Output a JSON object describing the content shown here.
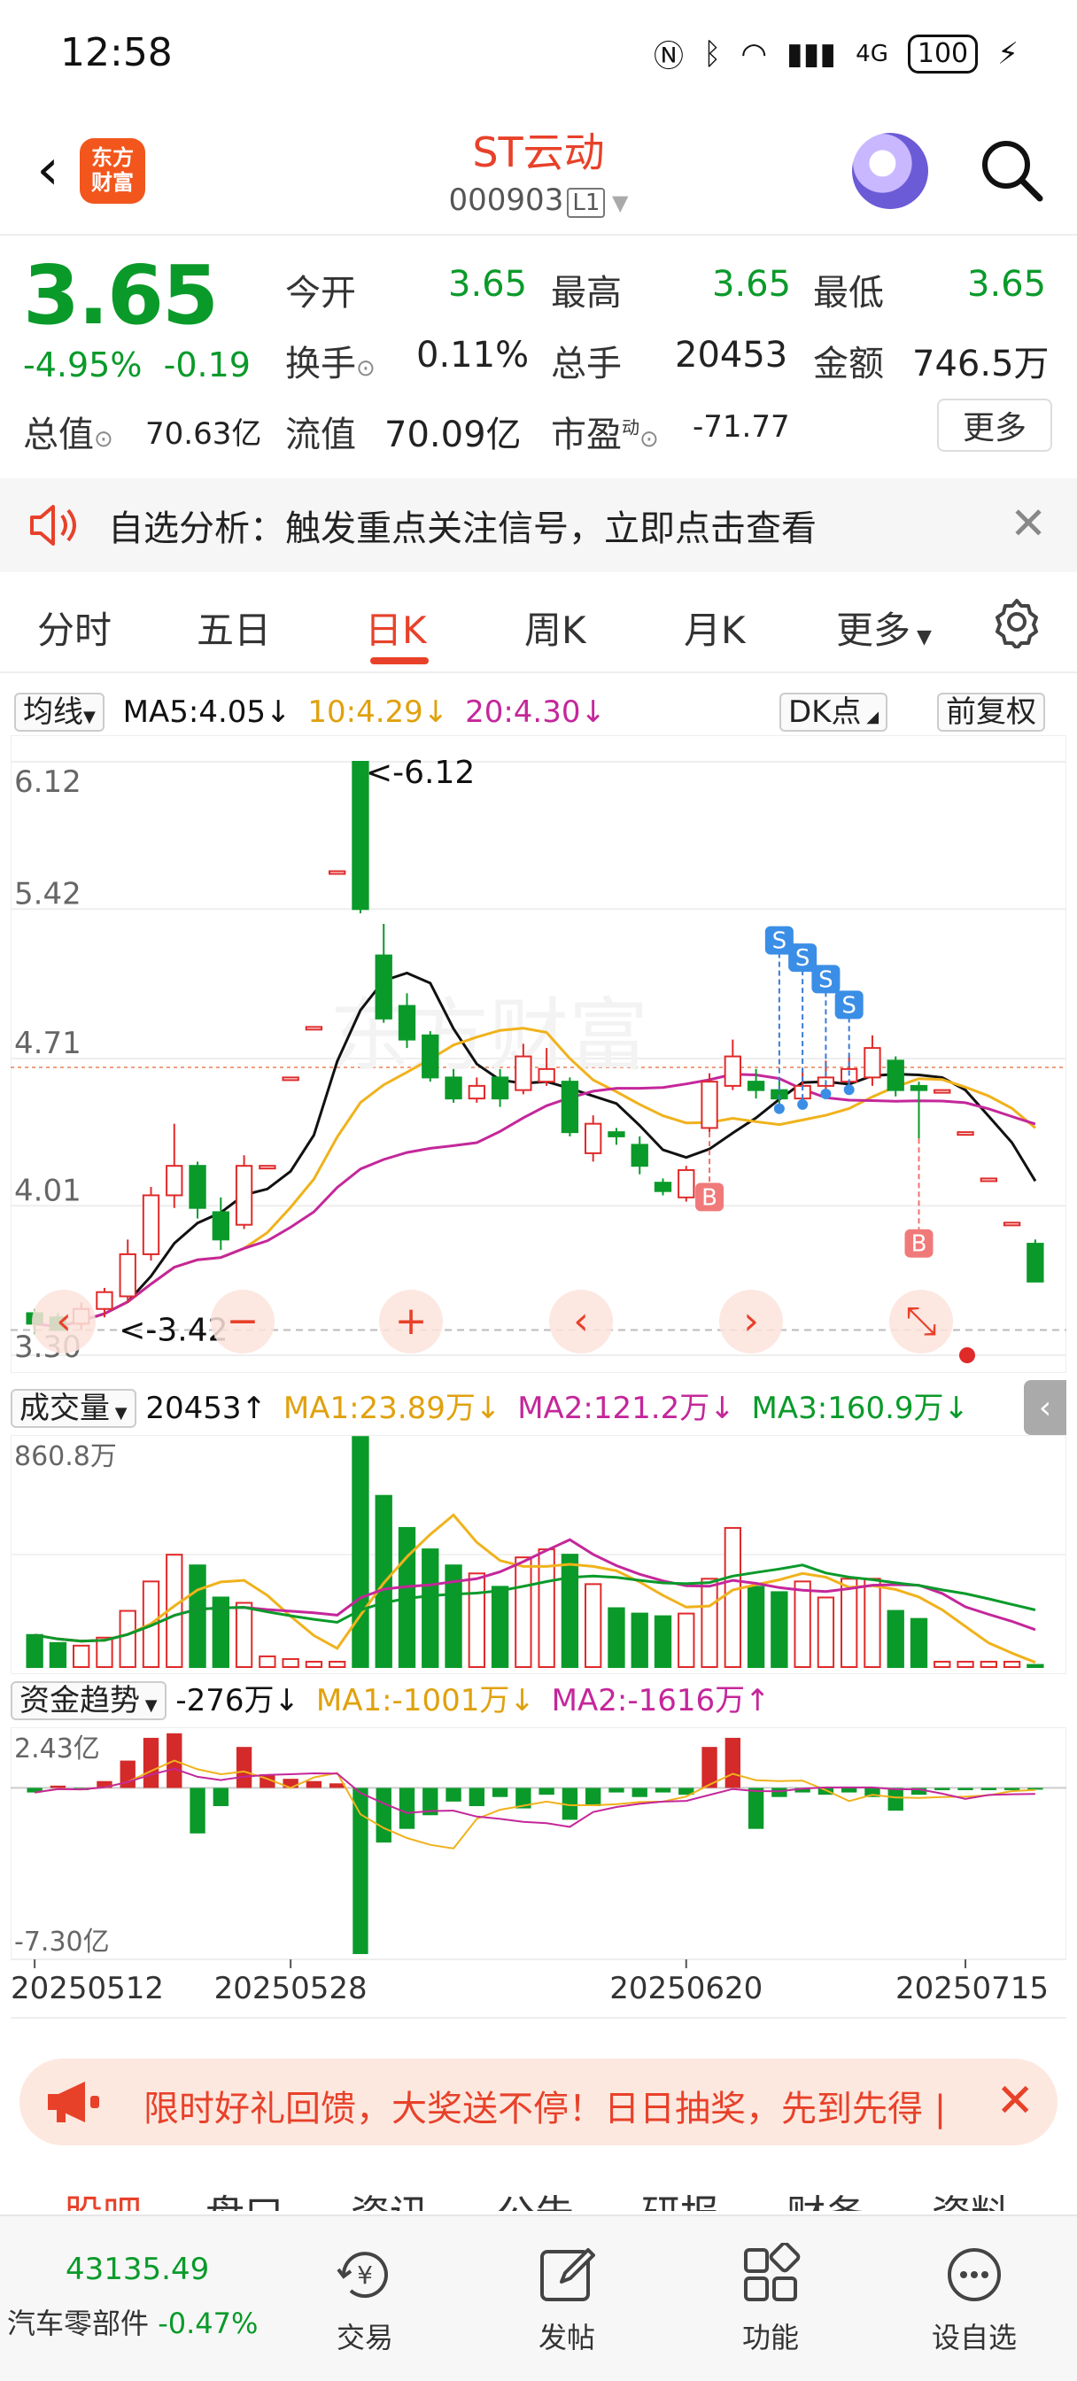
{
  "status_bar": {
    "time": "12:58",
    "network": "4G",
    "battery": "100"
  },
  "header": {
    "back_icon": "back-arrow-icon",
    "logo_line1": "东方",
    "logo_line2": "财富",
    "title": "ST云动",
    "code": "000903",
    "level": "L1"
  },
  "quote": {
    "price": "3.65",
    "change_pct": "-4.95%",
    "change": "-0.19",
    "open_label": "今开",
    "open": "3.65",
    "high_label": "最高",
    "high": "3.65",
    "low_label": "最低",
    "low": "3.65",
    "turnover_label": "换手",
    "turnover": "0.11%",
    "volume_label": "总手",
    "volume": "20453",
    "amount_label": "金额",
    "amount": "746.5万",
    "mktcap_label": "总值",
    "mktcap": "70.63亿",
    "float_label": "流值",
    "float_cap": "70.09亿",
    "pe_label": "市盈",
    "pe_sup": "动",
    "pe": "-71.77",
    "more": "更多"
  },
  "notice": {
    "text": "自选分析：触发重点关注信号，立即点击查看"
  },
  "tabs": [
    "分时",
    "五日",
    "日K",
    "周K",
    "月K",
    "更多"
  ],
  "active_tab": "日K",
  "kline": {
    "ma_selector": "均线",
    "ma5": "MA5:4.05↓",
    "ma10": "10:4.29↓",
    "ma20": "20:4.30↓",
    "dk": "DK点",
    "adjust": "前复权",
    "high_mark": "<-6.12",
    "low_mark": "<-3.42"
  },
  "volume": {
    "selector": "成交量",
    "value": "20453↑",
    "ma1": "MA1:23.89万↓",
    "ma2": "MA2:121.2万↓",
    "ma3": "MA3:160.9万↓",
    "max_label": "860.8万"
  },
  "fund": {
    "selector": "资金趋势",
    "value": "-276万↓",
    "ma1": "MA1:-1001万↓",
    "ma2": "MA2:-1616万↑",
    "max_label": "2.43亿",
    "min_label": "-7.30亿"
  },
  "dates": [
    "20250512",
    "20250528",
    "20250620",
    "20250715"
  ],
  "chart_data": {
    "type": "candlestick",
    "title": "",
    "ylim": [
      3.3,
      6.12
    ],
    "yticks": [
      6.12,
      5.42,
      4.71,
      4.01,
      3.3
    ],
    "candles": [
      {
        "o": 3.5,
        "c": 3.45,
        "h": 3.52,
        "l": 3.4
      },
      {
        "o": 3.48,
        "c": 3.42,
        "h": 3.5,
        "l": 3.42
      },
      {
        "o": 3.45,
        "c": 3.52,
        "h": 3.55,
        "l": 3.42
      },
      {
        "o": 3.52,
        "c": 3.6,
        "h": 3.62,
        "l": 3.48
      },
      {
        "o": 3.58,
        "c": 3.78,
        "h": 3.85,
        "l": 3.55
      },
      {
        "o": 3.78,
        "c": 4.06,
        "h": 4.1,
        "l": 3.75
      },
      {
        "o": 4.06,
        "c": 4.2,
        "h": 4.4,
        "l": 4.0
      },
      {
        "o": 4.2,
        "c": 4.0,
        "h": 4.22,
        "l": 3.95
      },
      {
        "o": 3.98,
        "c": 3.85,
        "h": 4.05,
        "l": 3.8
      },
      {
        "o": 3.92,
        "c": 4.2,
        "h": 4.25,
        "l": 3.9
      },
      {
        "o": 4.2,
        "c": 4.2,
        "h": 4.2,
        "l": 4.2
      },
      {
        "o": 4.62,
        "c": 4.62,
        "h": 4.62,
        "l": 4.62
      },
      {
        "o": 4.86,
        "c": 4.86,
        "h": 4.86,
        "l": 4.86
      },
      {
        "o": 5.6,
        "c": 5.6,
        "h": 5.6,
        "l": 5.6
      },
      {
        "o": 6.12,
        "c": 5.42,
        "h": 6.12,
        "l": 5.4
      },
      {
        "o": 5.2,
        "c": 4.9,
        "h": 5.35,
        "l": 4.88
      },
      {
        "o": 4.96,
        "c": 4.8,
        "h": 5.02,
        "l": 4.76
      },
      {
        "o": 4.82,
        "c": 4.62,
        "h": 4.84,
        "l": 4.6
      },
      {
        "o": 4.62,
        "c": 4.52,
        "h": 4.66,
        "l": 4.5
      },
      {
        "o": 4.52,
        "c": 4.58,
        "h": 4.62,
        "l": 4.5
      },
      {
        "o": 4.62,
        "c": 4.52,
        "h": 4.66,
        "l": 4.48
      },
      {
        "o": 4.56,
        "c": 4.72,
        "h": 4.78,
        "l": 4.54
      },
      {
        "o": 4.6,
        "c": 4.66,
        "h": 4.76,
        "l": 4.58
      },
      {
        "o": 4.6,
        "c": 4.36,
        "h": 4.62,
        "l": 4.34
      },
      {
        "o": 4.26,
        "c": 4.4,
        "h": 4.44,
        "l": 4.22
      },
      {
        "o": 4.36,
        "c": 4.34,
        "h": 4.38,
        "l": 4.3
      },
      {
        "o": 4.3,
        "c": 4.2,
        "h": 4.34,
        "l": 4.16
      },
      {
        "o": 4.12,
        "c": 4.08,
        "h": 4.14,
        "l": 4.06
      },
      {
        "o": 4.05,
        "c": 4.18,
        "h": 4.2,
        "l": 4.03
      },
      {
        "o": 4.38,
        "c": 4.6,
        "h": 4.64,
        "l": 4.36
      },
      {
        "o": 4.58,
        "c": 4.72,
        "h": 4.8,
        "l": 4.56
      },
      {
        "o": 4.6,
        "c": 4.56,
        "h": 4.66,
        "l": 4.52
      },
      {
        "o": 4.56,
        "c": 4.52,
        "h": 4.62,
        "l": 4.48
      },
      {
        "o": 4.52,
        "c": 4.58,
        "h": 4.66,
        "l": 4.5
      },
      {
        "o": 4.58,
        "c": 4.62,
        "h": 4.7,
        "l": 4.55
      },
      {
        "o": 4.6,
        "c": 4.66,
        "h": 4.72,
        "l": 4.57
      },
      {
        "o": 4.62,
        "c": 4.76,
        "h": 4.82,
        "l": 4.58
      },
      {
        "o": 4.7,
        "c": 4.56,
        "h": 4.72,
        "l": 4.53
      },
      {
        "o": 4.58,
        "c": 4.56,
        "h": 4.6,
        "l": 4.33
      },
      {
        "o": 4.56,
        "c": 4.56,
        "h": 4.56,
        "l": 4.56
      },
      {
        "o": 4.36,
        "c": 4.36,
        "h": 4.36,
        "l": 4.36
      },
      {
        "o": 4.14,
        "c": 4.14,
        "h": 4.14,
        "l": 4.14
      },
      {
        "o": 3.93,
        "c": 3.93,
        "h": 3.93,
        "l": 3.93
      },
      {
        "o": 3.83,
        "c": 3.65,
        "h": 3.85,
        "l": 3.65
      }
    ],
    "volume": [
      120,
      90,
      80,
      110,
      210,
      320,
      420,
      380,
      260,
      240,
      40,
      30,
      20,
      20,
      860,
      640,
      520,
      440,
      380,
      350,
      300,
      410,
      440,
      420,
      310,
      220,
      200,
      190,
      200,
      330,
      520,
      300,
      280,
      320,
      260,
      330,
      330,
      210,
      180,
      20,
      20,
      20,
      20,
      8
    ],
    "fund_flow": [
      -0.2,
      0.1,
      -0.1,
      0.3,
      1.2,
      2.2,
      2.4,
      -2.0,
      -0.8,
      1.8,
      0.6,
      0.4,
      0.3,
      0.2,
      -7.3,
      -2.4,
      -1.8,
      -1.2,
      -0.6,
      -0.8,
      -0.4,
      -0.9,
      -0.3,
      -1.4,
      -0.8,
      -0.2,
      -0.4,
      -0.2,
      -0.3,
      1.8,
      2.2,
      -1.8,
      -0.4,
      -0.2,
      -0.3,
      -0.2,
      -0.4,
      -1.0,
      -0.3,
      -0.1,
      -0.1,
      -0.1,
      -0.1,
      -0.05
    ]
  },
  "banner": {
    "text": "限时好礼回馈，大奖送不停！日日抽奖，先到先得 |"
  },
  "subtabs": [
    "股吧",
    "盘口",
    "资讯",
    "公告",
    "研报",
    "财务",
    "资料"
  ],
  "bottom_bar": {
    "index_value": "43135.49",
    "index_name": "汽车零部件",
    "index_change": "-0.47%",
    "items": [
      {
        "label": "交易",
        "icon": "trade-yen-icon"
      },
      {
        "label": "发帖",
        "icon": "post-edit-icon"
      },
      {
        "label": "功能",
        "icon": "grid-function-icon"
      },
      {
        "label": "设自选",
        "icon": "more-dots-icon"
      }
    ]
  },
  "colors": {
    "up": "#e02a2a",
    "down": "#0a9a2a",
    "ma5": "#111111",
    "ma10": "#f0b21c",
    "ma20": "#c4279a"
  }
}
